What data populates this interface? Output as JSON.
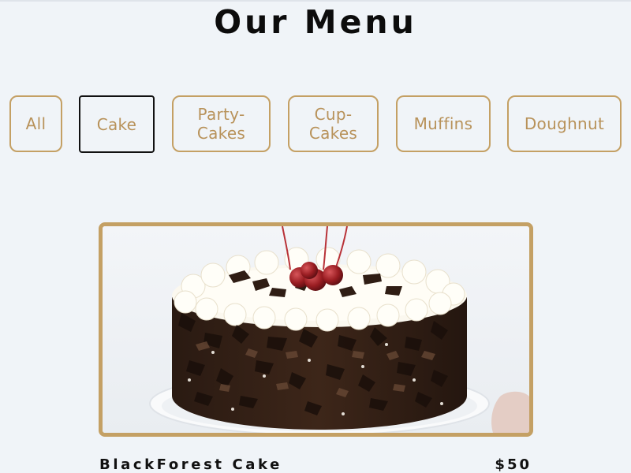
{
  "menu": {
    "title": "Our Menu"
  },
  "filters": [
    {
      "label": "All",
      "active": false
    },
    {
      "label": "Cake",
      "active": true
    },
    {
      "label": "Party-\nCakes",
      "active": false
    },
    {
      "label": "Cup-\nCakes",
      "active": false
    },
    {
      "label": "Muffins",
      "active": false
    },
    {
      "label": "Doughnut",
      "active": false
    }
  ],
  "products": [
    {
      "name": "BlackForest Cake",
      "price": "$50",
      "image": "black-forest-cake-image"
    }
  ],
  "colors": {
    "background": "#f0f4f8",
    "accent_gold": "#c4a064",
    "filter_text": "#b8925a",
    "title_text": "#0c0c0c"
  }
}
